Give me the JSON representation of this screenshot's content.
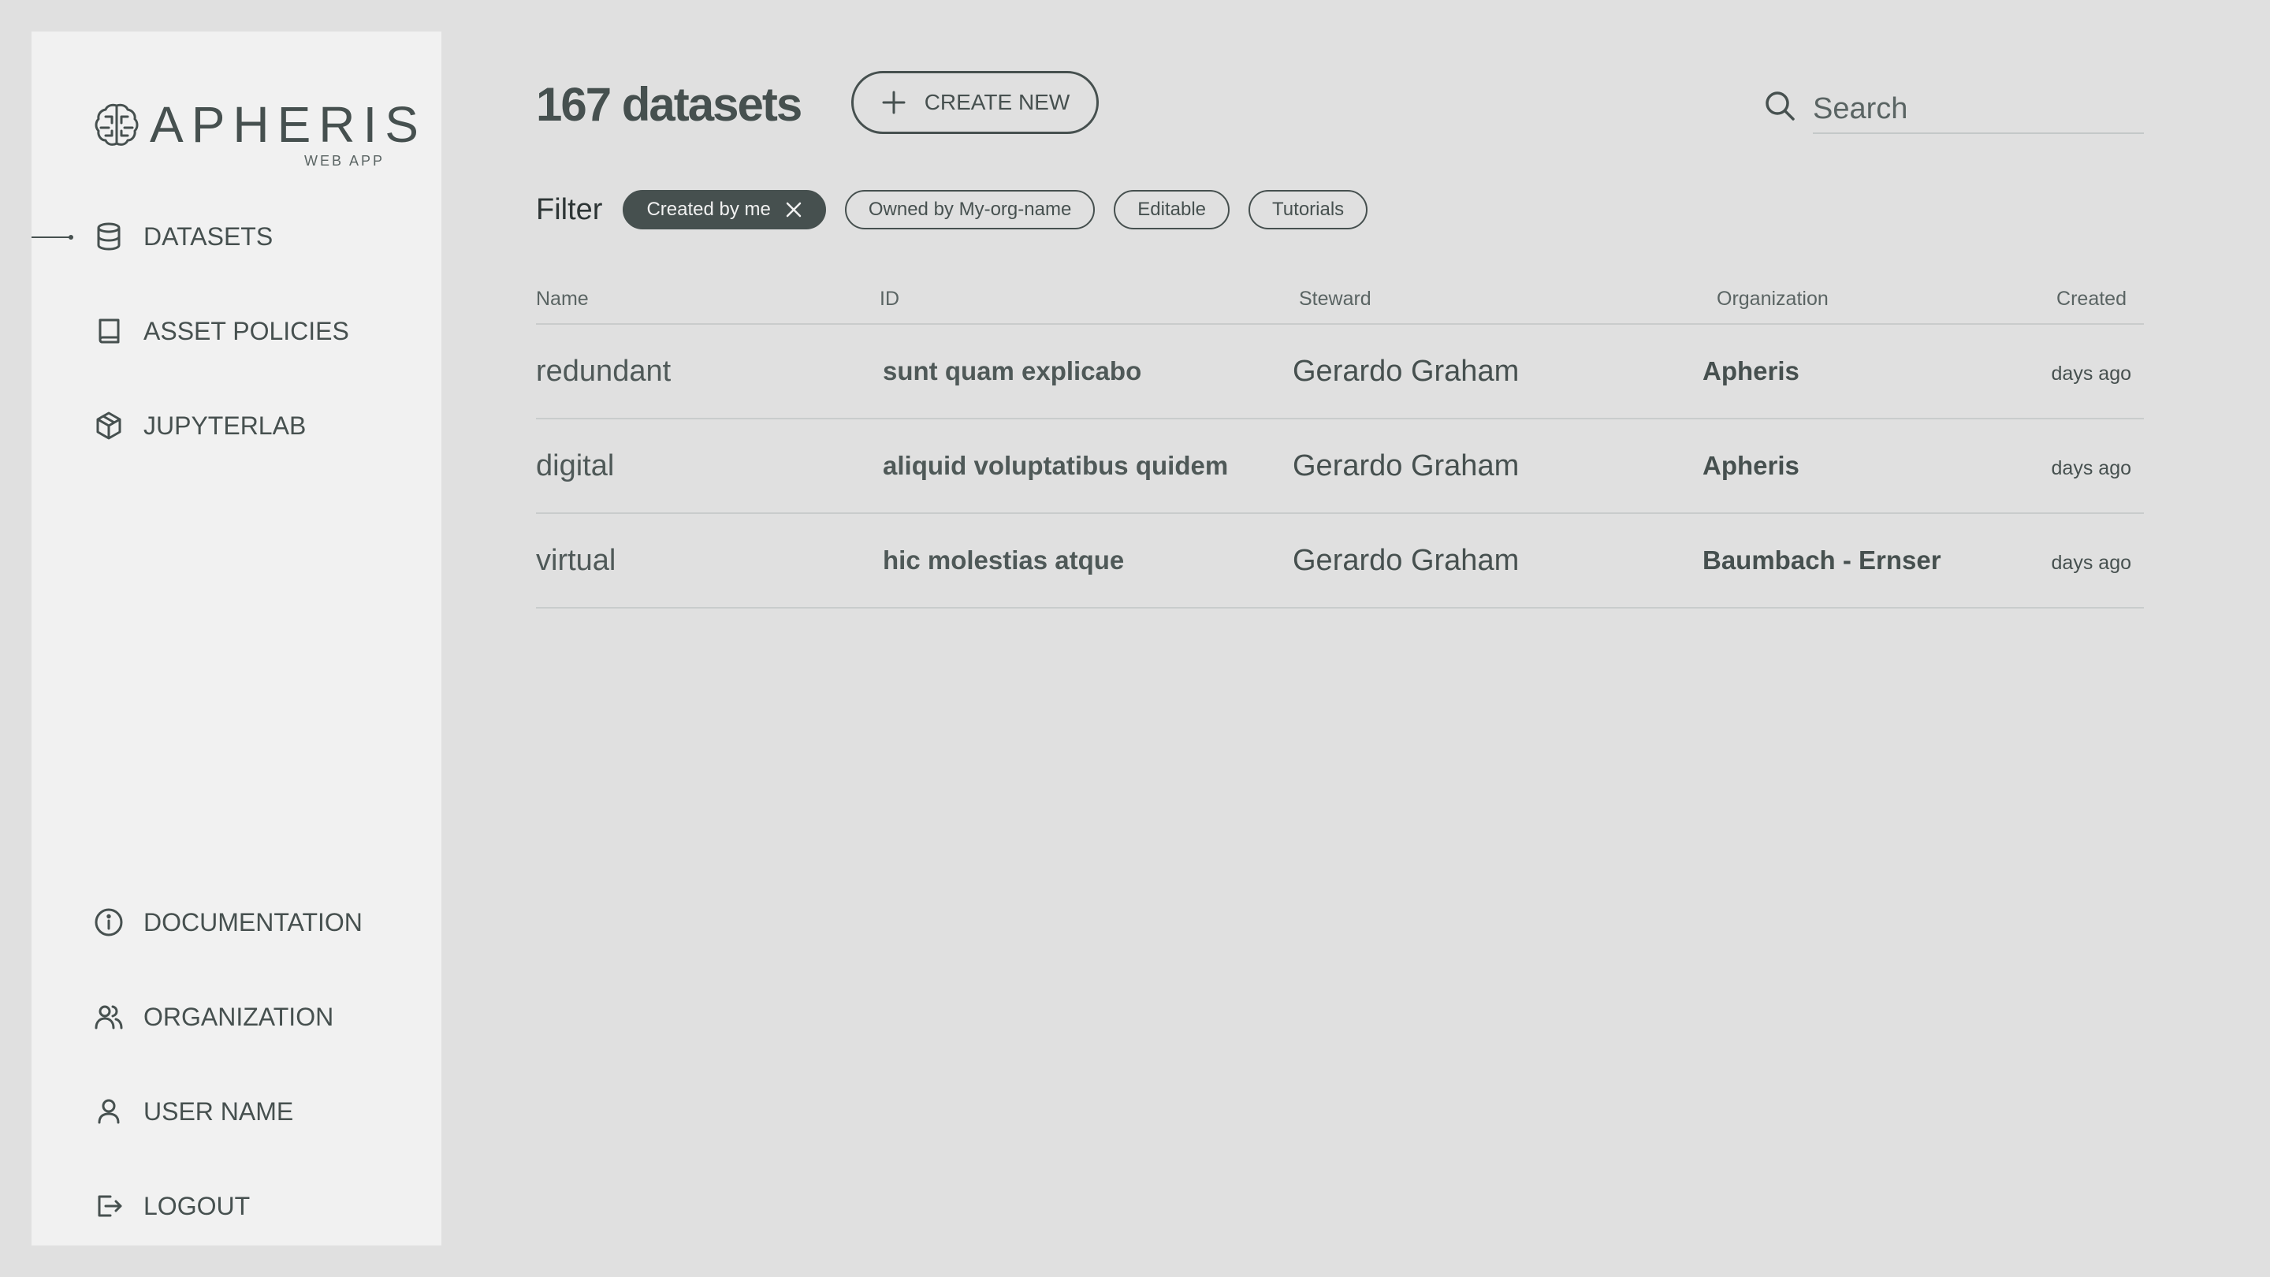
{
  "app": {
    "logo_text": "APHERIS",
    "logo_sub": "WEB APP"
  },
  "sidebar": {
    "top_items": [
      {
        "label": "DATASETS",
        "icon": "database-icon",
        "active": true
      },
      {
        "label": "ASSET POLICIES",
        "icon": "book-icon"
      },
      {
        "label": "JUPYTERLAB",
        "icon": "cube-icon"
      }
    ],
    "bottom_items": [
      {
        "label": "DOCUMENTATION",
        "icon": "info-icon"
      },
      {
        "label": "ORGANIZATION",
        "icon": "users-icon"
      },
      {
        "label": "USER NAME",
        "icon": "user-icon"
      },
      {
        "label": "LOGOUT",
        "icon": "logout-icon"
      }
    ]
  },
  "header": {
    "title": "167 datasets",
    "create_label": "CREATE NEW",
    "search_placeholder": "Search"
  },
  "filters": {
    "label": "Filter",
    "chips": [
      {
        "label": "Created by me",
        "active": true
      },
      {
        "label": "Owned by My-org-name",
        "active": false
      },
      {
        "label": "Editable",
        "active": false
      },
      {
        "label": "Tutorials",
        "active": false
      }
    ]
  },
  "table": {
    "columns": [
      "Name",
      "ID",
      "Steward",
      "Organization",
      "Created"
    ],
    "rows": [
      {
        "name": "redundant",
        "id": "sunt quam explicabo",
        "steward": "Gerardo Graham",
        "organization": "Apheris",
        "created": "days ago"
      },
      {
        "name": "digital",
        "id": "aliquid voluptatibus quidem",
        "steward": "Gerardo Graham",
        "organization": "Apheris",
        "created": "days ago"
      },
      {
        "name": "virtual",
        "id": "hic molestias atque",
        "steward": "Gerardo Graham",
        "organization": "Baumbach - Ernser",
        "created": "days ago"
      }
    ]
  },
  "colors": {
    "background": "#e0e0e0",
    "sidebar": "#f1f1f1",
    "text": "#46504f",
    "active_chip": "#46504f"
  }
}
